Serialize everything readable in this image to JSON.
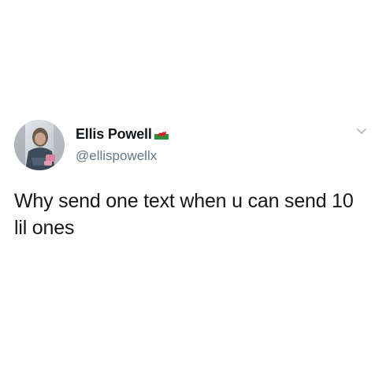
{
  "tweet": {
    "author": {
      "display_name": "Ellis Powell",
      "handle": "@ellispowellx",
      "avatar_icon": "user-photo-avatar",
      "badge_icon": "welsh-flag-emoji"
    },
    "menu_icon": "chevron-down-icon",
    "text": "Why send one text when u can send 10 lil ones"
  },
  "colors": {
    "primary_text": "#14171a",
    "secondary_text": "#657786",
    "chevron": "#aab8c2"
  }
}
